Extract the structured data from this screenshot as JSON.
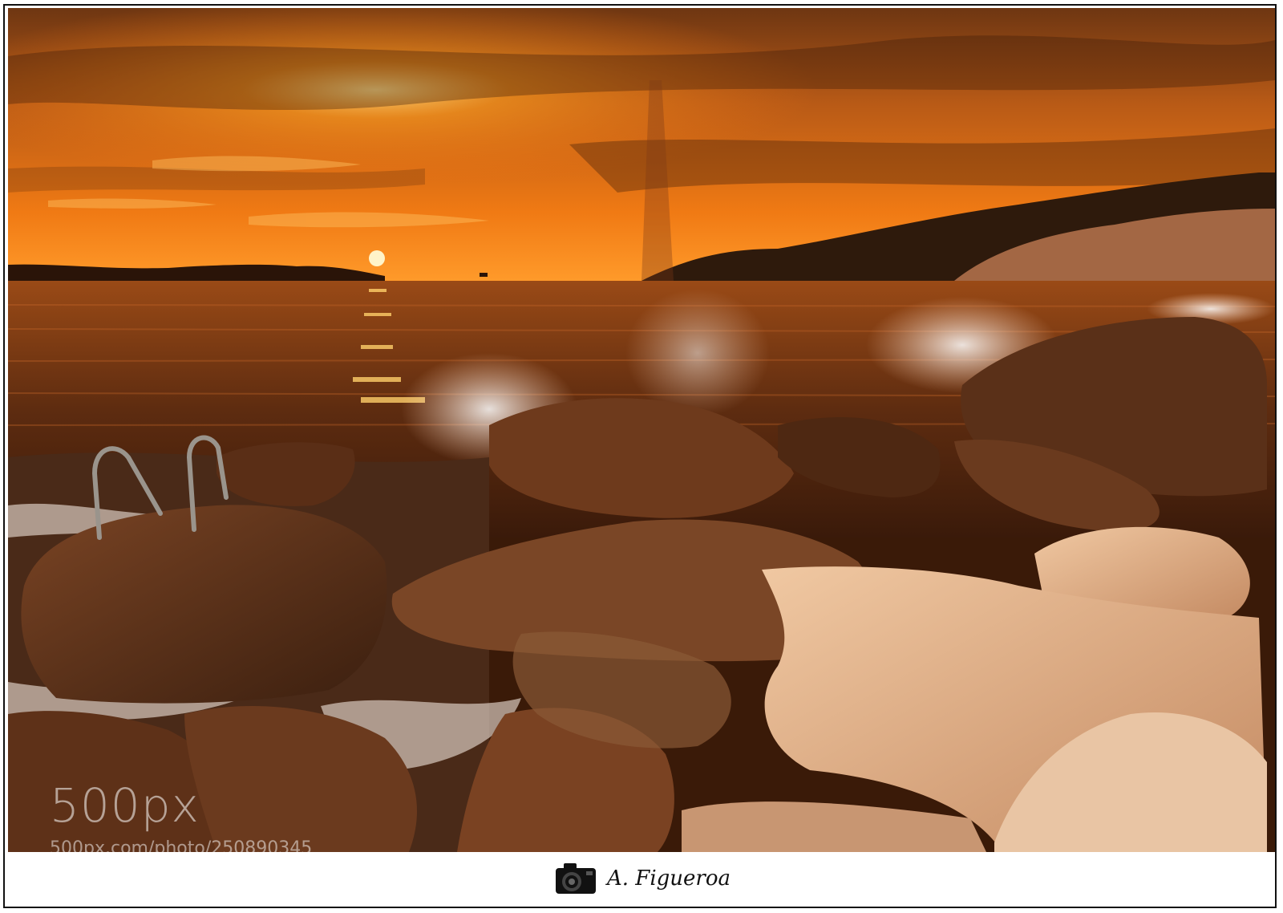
{
  "watermark": {
    "logo": "500px",
    "url": "500px.com/photo/250890345"
  },
  "signature": {
    "name": "A. Figueroa",
    "icon": "camera-icon"
  },
  "colors": {
    "sky_top": "#7a3a12",
    "sky_glow": "#ff8a1a",
    "sun": "#fff4c8",
    "sea": "#5a2a10",
    "rock": "#6b3a1e",
    "rock_light": "#e7b892"
  }
}
